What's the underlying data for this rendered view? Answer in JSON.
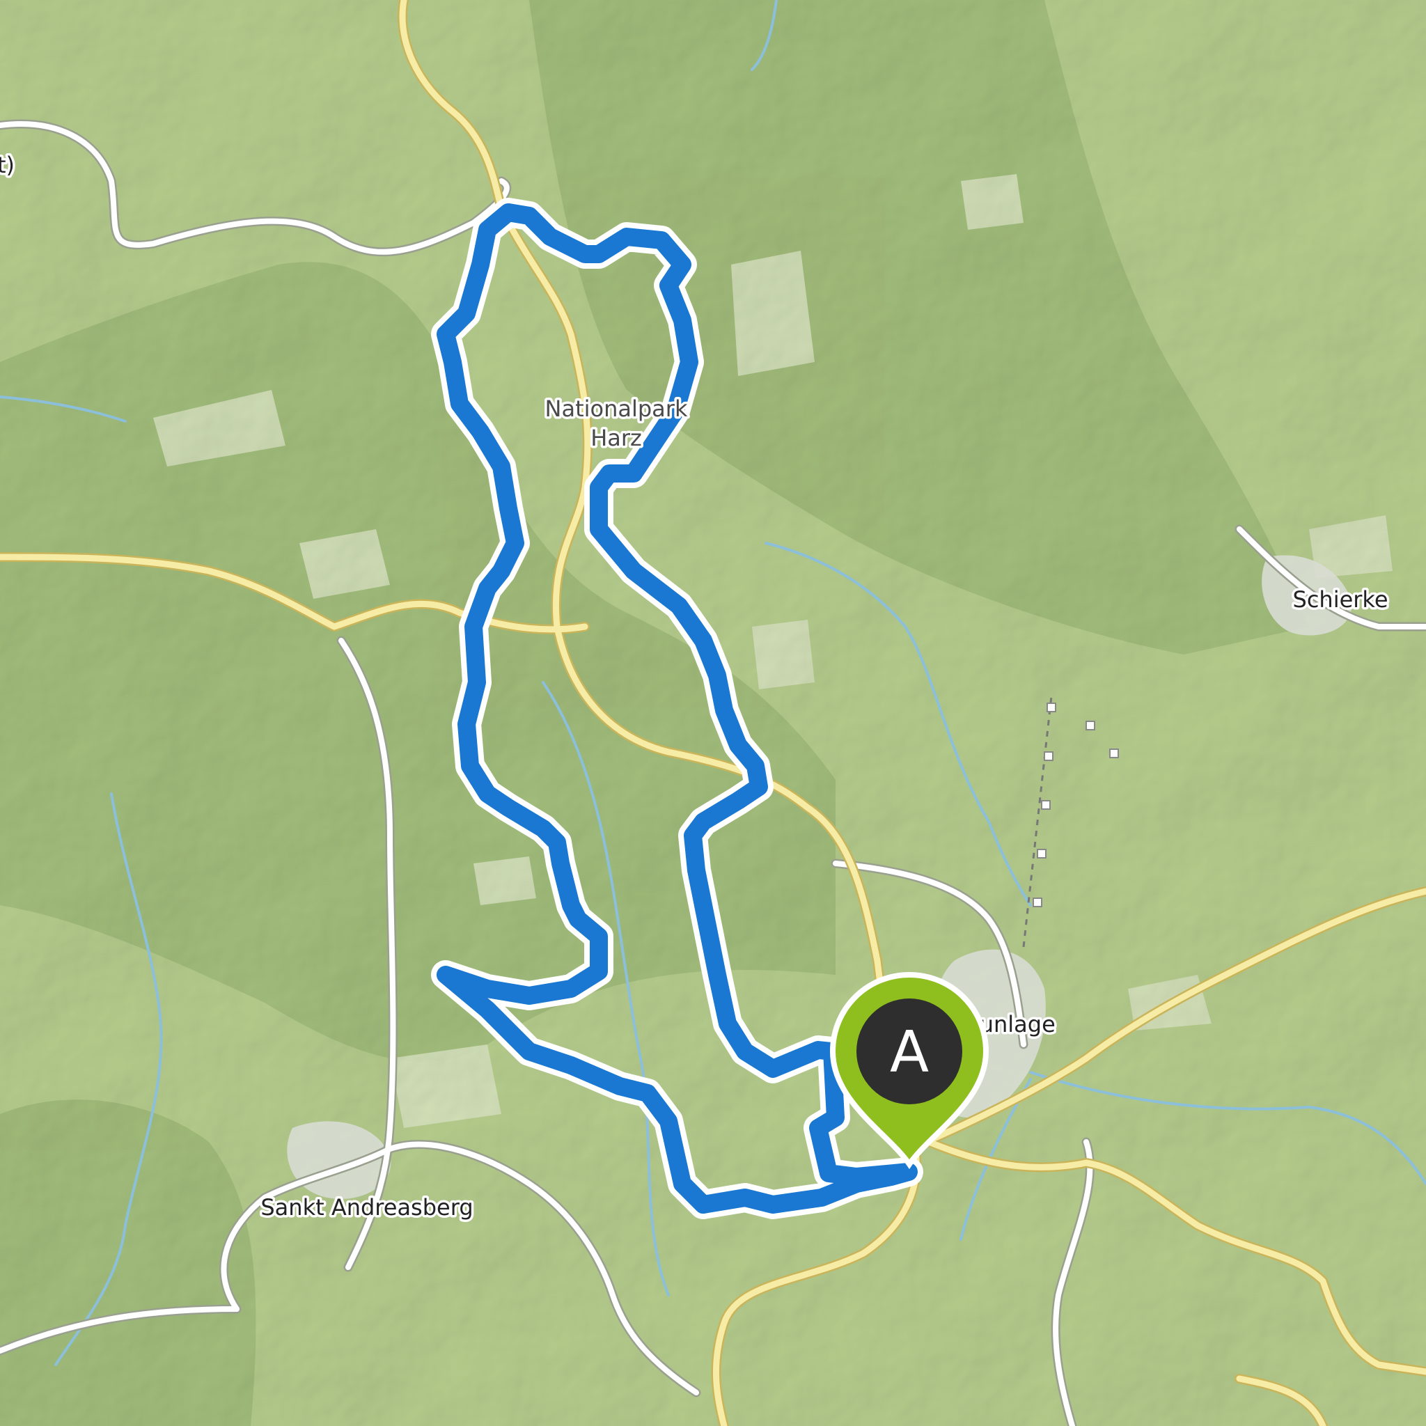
{
  "map": {
    "places": [
      {
        "id": "nationalpark",
        "name_line1": "Nationalpark",
        "name_line2": "Harz"
      },
      {
        "id": "schierke",
        "name": "Schierke"
      },
      {
        "id": "braunlage",
        "name": "Braunlage"
      },
      {
        "id": "sankt-andreasberg",
        "name": "Sankt Andreasberg"
      },
      {
        "id": "edge",
        "name": "t)"
      }
    ],
    "route": {
      "color": "#1a78d2",
      "outline_color": "#ffffff",
      "type": "loop"
    },
    "start_marker": {
      "letter": "A",
      "pin_color": "#8fbf1e",
      "inner_color": "#2e2e2e"
    },
    "colors": {
      "terrain": "#b9d08f",
      "forest": "#a4c07c",
      "clearing": "#dbe7c2",
      "main_road": "#f5e9a2",
      "minor_road": "#ffffff",
      "water": "#8ec0da",
      "settlement": "#d9ddd2"
    }
  }
}
